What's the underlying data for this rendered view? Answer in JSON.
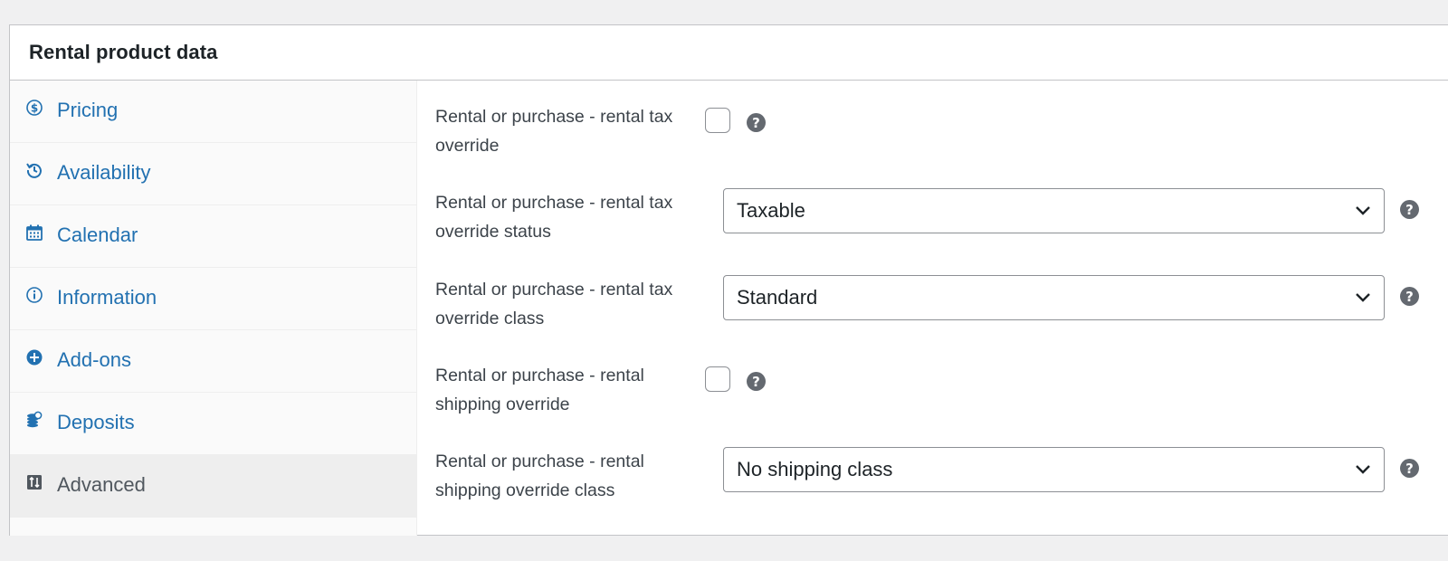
{
  "panel": {
    "title": "Rental product data"
  },
  "tabs": [
    {
      "label": "Pricing",
      "icon": "dollar-icon"
    },
    {
      "label": "Availability",
      "icon": "history-icon"
    },
    {
      "label": "Calendar",
      "icon": "calendar-icon"
    },
    {
      "label": "Information",
      "icon": "info-icon"
    },
    {
      "label": "Add-ons",
      "icon": "plus-circle-icon"
    },
    {
      "label": "Deposits",
      "icon": "coins-icon"
    },
    {
      "label": "Advanced",
      "icon": "sliders-icon",
      "active": true
    }
  ],
  "fields": {
    "tax_override": {
      "label": "Rental or purchase - rental tax override",
      "type": "checkbox",
      "checked": false
    },
    "tax_override_status": {
      "label": "Rental or purchase - rental tax override status",
      "type": "select",
      "value": "Taxable"
    },
    "tax_override_class": {
      "label": "Rental or purchase - rental tax override class",
      "type": "select",
      "value": "Standard"
    },
    "shipping_override": {
      "label": "Rental or purchase - rental shipping override",
      "type": "checkbox",
      "checked": false
    },
    "shipping_override_class": {
      "label": "Rental or purchase - rental shipping override class",
      "type": "select",
      "value": "No shipping class"
    }
  },
  "help_glyph": "?",
  "colors": {
    "link": "#2271b1",
    "active_text": "#50575e",
    "help_bg": "#646970"
  }
}
